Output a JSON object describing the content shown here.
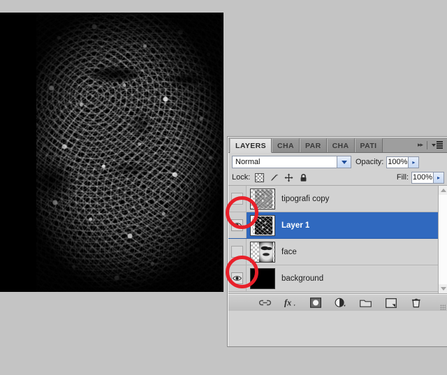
{
  "document": {
    "canvas_label": "typography-face-artwork",
    "background_color": "#000000"
  },
  "panel": {
    "tabs": [
      {
        "label": "LAYERS",
        "active": true
      },
      {
        "label": "CHA",
        "active": false
      },
      {
        "label": "PAR",
        "active": false
      },
      {
        "label": "CHA",
        "active": false
      },
      {
        "label": "PATI",
        "active": false
      }
    ],
    "tab_controls": {
      "expand_label": "▸▸",
      "menu_icon": "panel-menu-icon"
    },
    "blend_mode": {
      "value": "Normal",
      "dropdown_icon": "chevron-down-icon"
    },
    "opacity": {
      "label": "Opacity:",
      "value": "100%",
      "spinner_icon": "chevron-right-icon"
    },
    "fill": {
      "label": "Fill:",
      "value": "100%",
      "spinner_icon": "chevron-right-icon"
    },
    "lock": {
      "label": "Lock:",
      "icons": [
        "lock-transparent-pixels-icon",
        "lock-image-pixels-icon",
        "lock-position-icon",
        "lock-all-icon"
      ]
    },
    "layers": [
      {
        "name": "tipografi copy",
        "visible": false,
        "selected": false,
        "thumbnail": "transparent-typography-faint",
        "annotated": true
      },
      {
        "name": "Layer 1",
        "visible": true,
        "selected": true,
        "thumbnail": "transparent-typography-face",
        "annotated": false
      },
      {
        "name": "face",
        "visible": false,
        "selected": false,
        "thumbnail": "transparent-face-photo",
        "annotated": true
      },
      {
        "name": "background",
        "visible": true,
        "selected": false,
        "thumbnail": "solid-black",
        "annotated": false
      }
    ],
    "bottom_toolbar": [
      "link-layers-icon",
      "layer-styles-fx-icon",
      "add-layer-mask-icon",
      "new-adjustment-layer-icon",
      "new-group-folder-icon",
      "new-layer-icon",
      "delete-layer-trash-icon"
    ],
    "scrollbar": {
      "up_icon": "chevron-up-icon",
      "down_icon": "chevron-down-icon"
    },
    "colors": {
      "selection_blue": "#3069bf",
      "panel_gray": "#d2d2d2",
      "annotation_red": "#e8202a"
    }
  },
  "annotations": {
    "rings": [
      {
        "target": "visibility-toggle-tipografi-copy"
      },
      {
        "target": "visibility-toggle-face"
      }
    ]
  }
}
